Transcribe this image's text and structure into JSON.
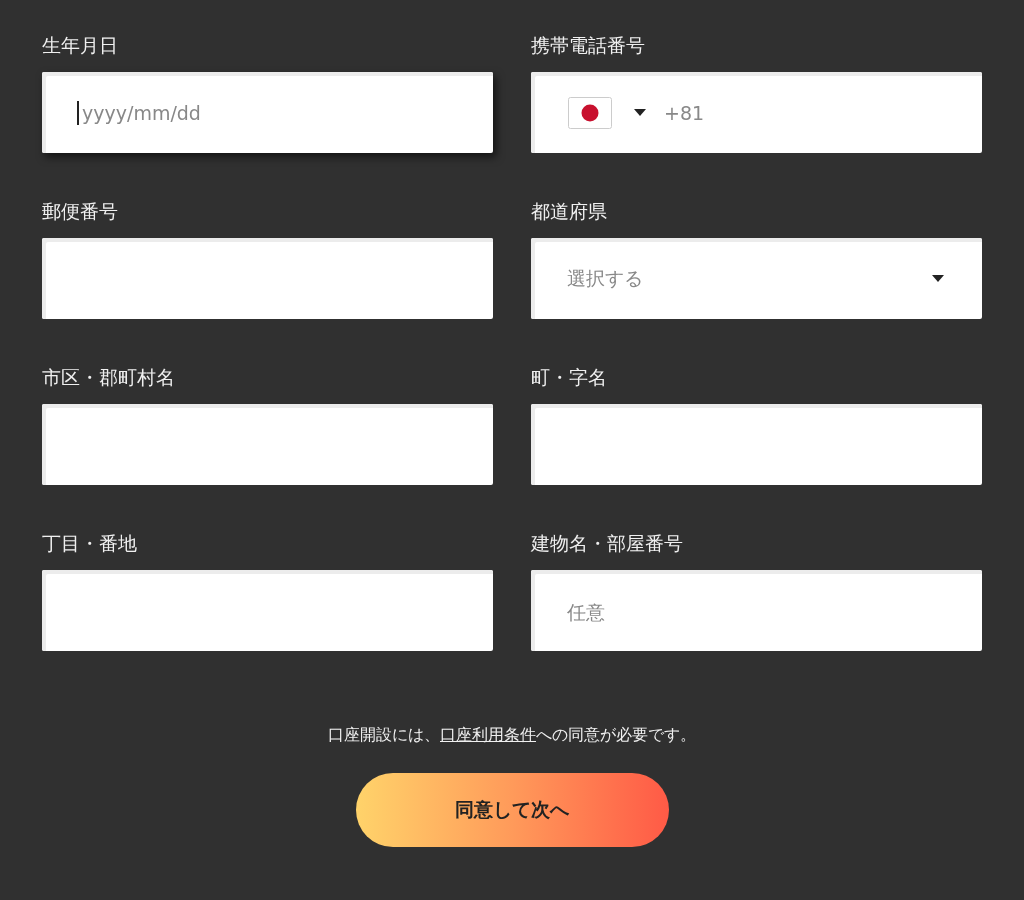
{
  "fields": [
    {
      "label": "生年月日",
      "kind": "date",
      "placeholder": "yyyy/mm/dd",
      "focused": true
    },
    {
      "label": "携帯電話番号",
      "kind": "phone",
      "value": "+81",
      "focused": false
    },
    {
      "label": "郵便番号",
      "kind": "text",
      "focused": false
    },
    {
      "label": "都道府県",
      "kind": "select",
      "placeholder": "選択する",
      "focused": false
    },
    {
      "label": "市区・郡町村名",
      "kind": "text",
      "focused": false
    },
    {
      "label": "町・字名",
      "kind": "text",
      "focused": false
    },
    {
      "label": "丁目・番地",
      "kind": "text",
      "focused": false
    },
    {
      "label": "建物名・部屋番号",
      "kind": "text",
      "placeholder": "任意",
      "focused": false
    }
  ],
  "terms": {
    "before": "口座開設には、",
    "link": "口座利用条件",
    "after": "への同意が必要です。"
  },
  "submit_button": "同意して次へ"
}
